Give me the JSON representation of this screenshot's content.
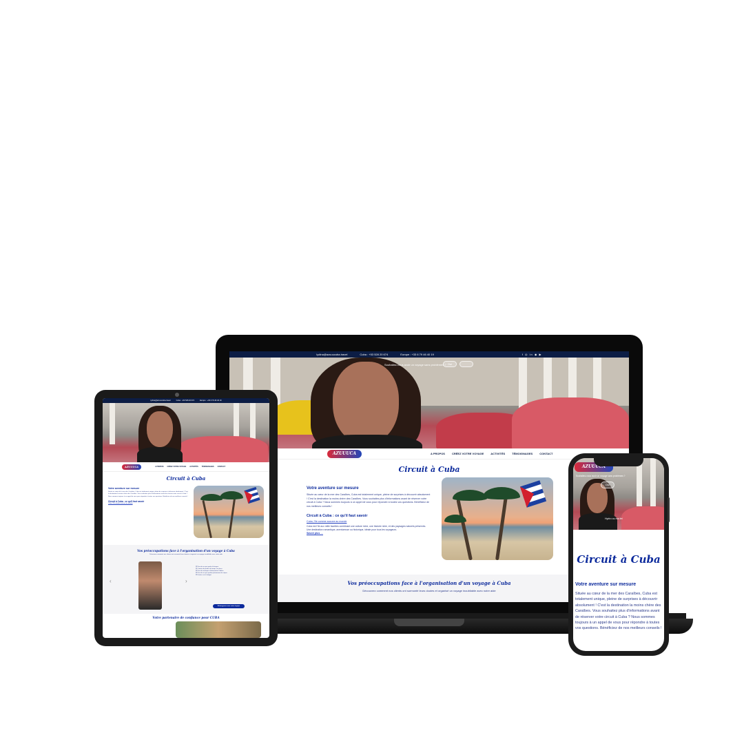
{
  "site": {
    "topbar": {
      "email": "lydina@azuuucuba.travel",
      "cuba_phone": "Cuba : +53 528 20 674",
      "europe_phone": "Europe : +33 6 79 46 40 19"
    },
    "promo": {
      "question": "Souhaitez-vous avoir un voyage sans problèmes ?",
      "yes": "Oui"
    },
    "logo": "AZUUUCA",
    "nav": [
      "A PROPOS",
      "CRÉEZ VOTRE VOYAGE",
      "ACTIVITÉS",
      "TÉMOIGNAGES",
      "CONTACT"
    ],
    "page_title": "Circuit à Cuba",
    "adventure_heading": "Votre aventure sur mesure",
    "adventure_text": "Située au cœur de la mer des Caraïbes, Cuba est totalement unique, pleine de surprises à découvrir absolument ! C'est la destination la moins chère des Caraïbes. Vous souhaitez plus d'informations avant de réserver votre circuit à Cuba ? Nous sommes toujours à un appel de vous pour répondre à toutes vos questions. Bénéficiez de nos meilleurs conseils !",
    "know_heading": "Circuit à Cuba : ce qu'il faut savoir",
    "know_link": "Cuba, l'île comme aucune au monde",
    "know_text": "Cuba est l'île aux mille facettes combinant une culture riche, une histoire riche, et des paysages naturels préservés. Une destination romantique, aventureuse ou historique, idéale pour tous les voyageurs.",
    "read_more": "Savoir plus →",
    "concerns_heading": "Vos préoccupations face à l'organisation d'un voyage à Cuba",
    "concerns_sub": "Découvrez comment nos clients ont surmonté leurs doutes et organisé un voyage inoubliable avec notre aide",
    "checklist": [
      "Peur de ne pas parler la langue",
      "Crainte de perdre du temps sur place",
      "Peur de manquer d'informations fiables",
      "Peur de ne pas profiter pleinement du séjour",
      "Doutes sur le budget"
    ],
    "cta": "Échangeons avec notre équipe",
    "partner_heading": "Votre partenaire de confiance pour CUBA",
    "video_caption": "Hydro ou ma fet"
  }
}
